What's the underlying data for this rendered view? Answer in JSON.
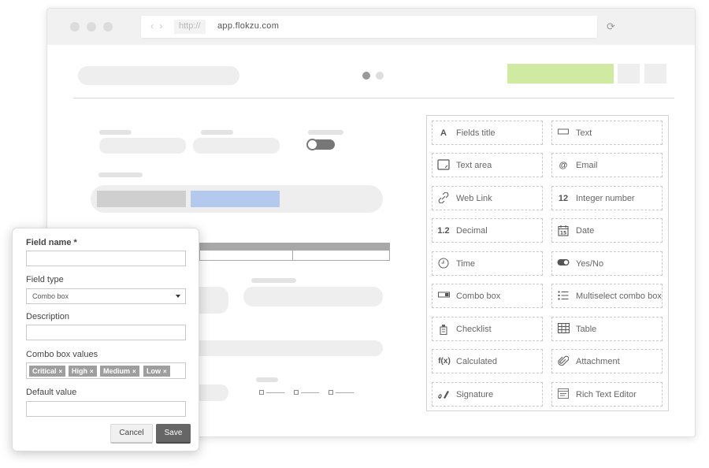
{
  "browser": {
    "nav_arrows": "‹ ›",
    "url_protocol": "http://",
    "url_host": "app.flokzu.com",
    "reload_icon": "⟳"
  },
  "colors": {
    "accent_green": "#d0eaa2",
    "accent_blue": "#b3c9ee",
    "save_button": "#666666"
  },
  "palette": {
    "items": [
      {
        "label": "Fields title",
        "icon": "A",
        "icon_name": "fields-title-icon"
      },
      {
        "label": "Text",
        "icon": "▭",
        "icon_name": "text-icon"
      },
      {
        "label": "Text area",
        "icon": "⊡",
        "icon_name": "text-area-icon"
      },
      {
        "label": "Email",
        "icon": "@",
        "icon_name": "email-icon"
      },
      {
        "label": "Web Link",
        "icon": "🔗",
        "icon_name": "link-icon"
      },
      {
        "label": "Integer number",
        "icon": "12",
        "icon_name": "integer-icon"
      },
      {
        "label": "Decimal",
        "icon": "1.2",
        "icon_name": "decimal-icon"
      },
      {
        "label": "Date",
        "icon": "15",
        "icon_name": "calendar-icon"
      },
      {
        "label": "Time",
        "icon": "◷",
        "icon_name": "clock-icon"
      },
      {
        "label": "Yes/No",
        "icon": "",
        "icon_name": "toggle-icon"
      },
      {
        "label": "Combo box",
        "icon": "▭",
        "icon_name": "combo-box-icon"
      },
      {
        "label": "Multiselect combo box",
        "icon": "☰",
        "icon_name": "multiselect-icon"
      },
      {
        "label": "Checklist",
        "icon": "☑",
        "icon_name": "checklist-icon"
      },
      {
        "label": "Table",
        "icon": "▦",
        "icon_name": "table-icon"
      },
      {
        "label": "Calculated",
        "icon": "f(x)",
        "icon_name": "function-icon"
      },
      {
        "label": "Attachment",
        "icon": "📎",
        "icon_name": "paperclip-icon"
      },
      {
        "label": "Signature",
        "icon": "✍",
        "icon_name": "signature-icon"
      },
      {
        "label": "Rich Text Editor",
        "icon": "▤",
        "icon_name": "rich-text-icon"
      }
    ]
  },
  "modal": {
    "field_name_label": "Field name *",
    "field_name_value": "",
    "field_type_label": "Field type",
    "field_type_value": "Combo box",
    "description_label": "Description",
    "description_value": "",
    "combo_values_label": "Combo box values",
    "combo_values": [
      "Critical",
      "High",
      "Medium",
      "Low"
    ],
    "default_value_label": "Default value",
    "default_value_value": "",
    "cancel_label": "Cancel",
    "save_label": "Save",
    "tag_remove_glyph": "×"
  }
}
